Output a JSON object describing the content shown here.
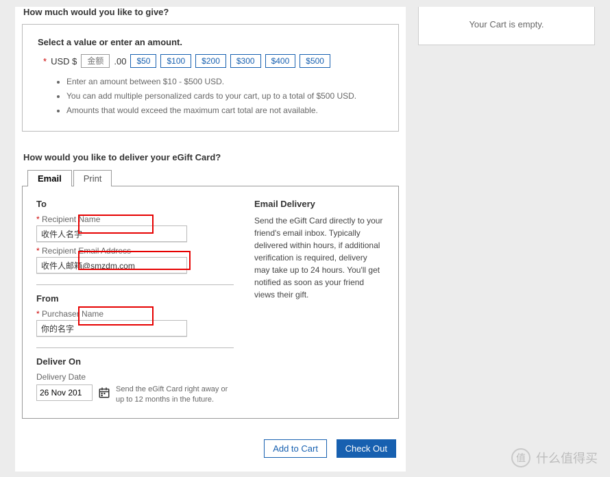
{
  "cart": {
    "empty_text": "Your Cart is empty."
  },
  "amount": {
    "title": "How much would you like to give?",
    "header": "Select a value or enter an amount.",
    "currency_label": "USD $",
    "input_placeholder": "金额",
    "cents": ".00",
    "presets": [
      "$50",
      "$100",
      "$200",
      "$300",
      "$400",
      "$500"
    ],
    "bullets": [
      "Enter an amount between $10 - $500 USD.",
      "You can add multiple personalized cards to your cart, up to a total of $500 USD.",
      "Amounts that would exceed the maximum cart total are not available."
    ]
  },
  "delivery": {
    "title": "How would you like to deliver your eGift Card?",
    "tabs": {
      "email": "Email",
      "print": "Print"
    },
    "to_label": "To",
    "from_label": "From",
    "recipient_name_label": "Recipient Name",
    "recipient_name_value": "收件人名字",
    "recipient_email_label": "Recipient Email Address",
    "recipient_email_value": "收件人邮箱@smzdm.com",
    "purchaser_name_label": "Purchaser Name",
    "purchaser_name_value": "你的名字",
    "deliver_on_label": "Deliver On",
    "delivery_date_label": "Delivery Date",
    "delivery_date_value": "26 Nov 201",
    "delivery_note": "Send the eGift Card right away or up to 12 months in the future.",
    "right_title": "Email Delivery",
    "right_desc": "Send the eGift Card directly to your friend's email inbox. Typically delivered within hours, if additional verification is required, delivery may take up to 24 hours. You'll get notified as soon as your friend views their gift."
  },
  "buttons": {
    "add_to_cart": "Add to Cart",
    "check_out": "Check Out"
  },
  "watermark": {
    "char": "值",
    "text": "什么值得买"
  }
}
